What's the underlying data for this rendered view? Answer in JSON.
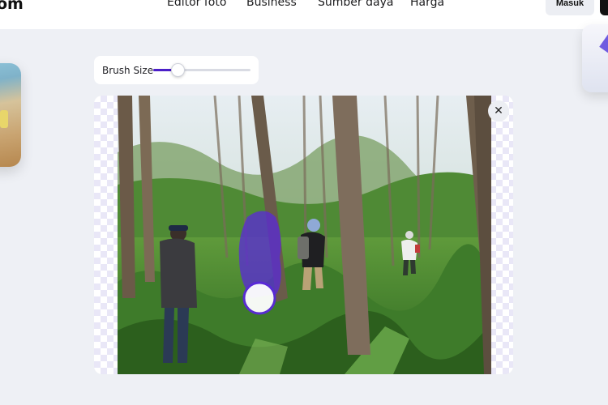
{
  "header": {
    "logo_text": "om",
    "nav": [
      "Editor foto",
      "Business",
      "Sumber daya",
      "Harga"
    ],
    "login_label": "Masuk"
  },
  "brush": {
    "label": "Brush Size",
    "value_fraction": 0.25
  },
  "editor": {
    "close_glyph": "✕"
  },
  "colors": {
    "accent": "#4b1fc8",
    "mask": "#5a28d9",
    "page_bg": "#eef0f5"
  },
  "icons": [
    "close-icon"
  ]
}
